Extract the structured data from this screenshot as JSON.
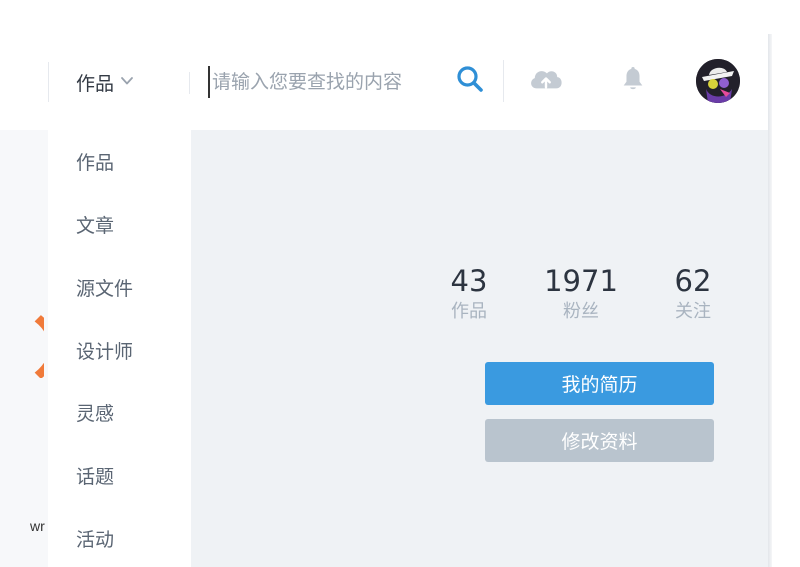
{
  "header": {
    "category_label": "作品",
    "category_icon": "chevron-down-icon",
    "search_placeholder": "请输入您要查找的内容",
    "search_icon": "search-icon",
    "upload_icon": "cloud-upload-icon",
    "notification_icon": "bell-icon",
    "avatar_icon": "avatar"
  },
  "dropdown": {
    "items": [
      "作品",
      "文章",
      "源文件",
      "设计师",
      "灵感",
      "话题",
      "活动"
    ]
  },
  "profile": {
    "stats": [
      {
        "value": "43",
        "label": "作品"
      },
      {
        "value": "1971",
        "label": "粉丝"
      },
      {
        "value": "62",
        "label": "关注"
      }
    ],
    "resume_button": "我的简历",
    "edit_button": "修改资料"
  },
  "background": {
    "partial_text": "wr"
  },
  "colors": {
    "accent": "#3a9ae0",
    "search_icon": "#2f8fd6",
    "muted_button": "#b9c4ce",
    "main_bg": "#eff2f5",
    "icon_gray": "#c4cbd3"
  }
}
